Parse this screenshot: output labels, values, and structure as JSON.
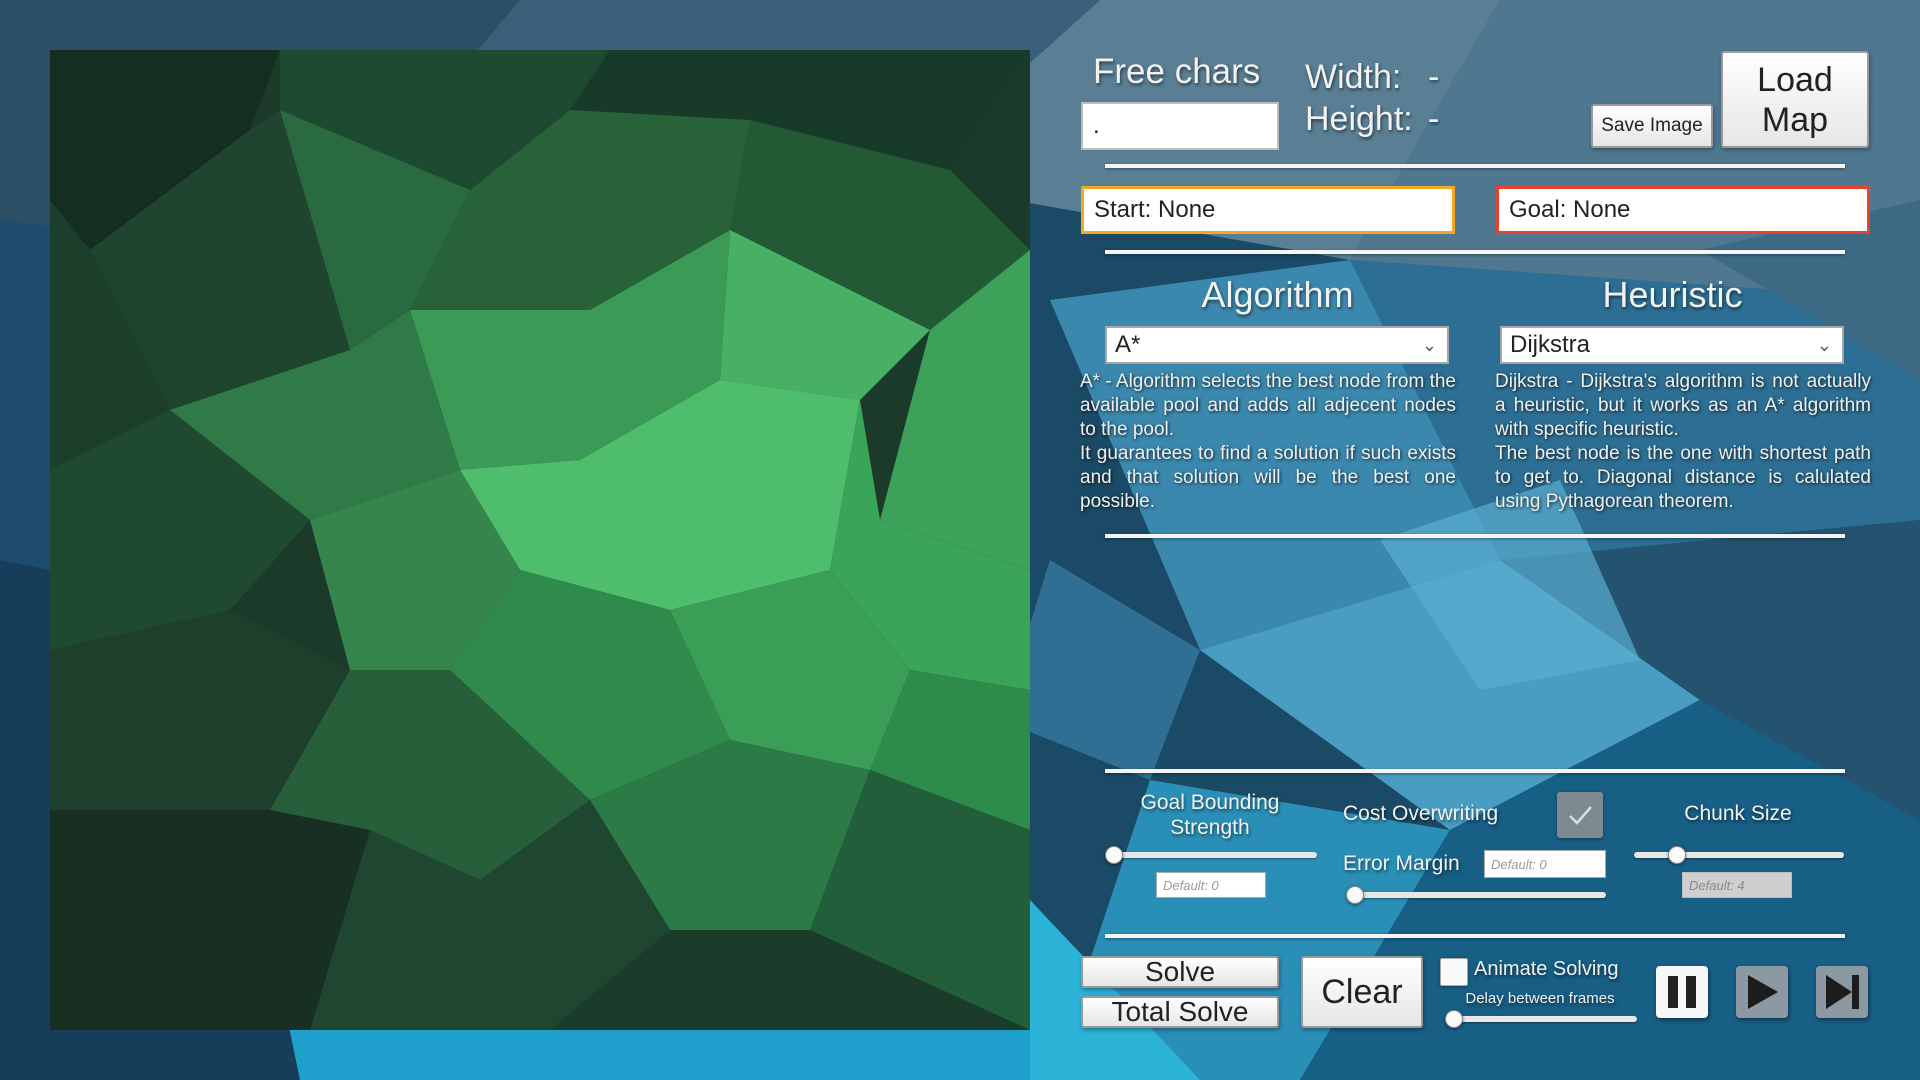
{
  "header": {
    "free_chars_label": "Free chars",
    "free_chars_value": ".",
    "width_label": "Width:",
    "width_value": "-",
    "height_label": "Height:",
    "height_value": "-",
    "save_image_label": "Save Image",
    "load_map_line1": "Load",
    "load_map_line2": "Map"
  },
  "points": {
    "start_label": "Start: None",
    "goal_label": "Goal: None",
    "start_border_color": "#f5a623",
    "goal_border_color": "#e8412c"
  },
  "algorithm": {
    "title": "Algorithm",
    "selected": "A*",
    "description": [
      "A* - Algorithm selects the best node from the available pool and adds all adjecent nodes to the pool.",
      "It guarantees to find a solution if such exists and that solution will be the best one possible."
    ]
  },
  "heuristic": {
    "title": "Heuristic",
    "selected": "Dijkstra",
    "description": [
      "Dijkstra - Dijkstra's algorithm is not actually a heuristic, but it works as an A* algorithm with specific heuristic.",
      "The best node is the one with shortest path to get to. Diagonal distance is calulated using Pythagorean theorem."
    ]
  },
  "settings": {
    "goal_bounding_label": "Goal Bounding Strength",
    "goal_bounding_placeholder": "Default: 0",
    "goal_bounding_level": 0,
    "cost_overwriting_label": "Cost Overwriting",
    "cost_overwriting_checked": true,
    "error_margin_label": "Error Margin",
    "error_margin_placeholder": "Default: 0",
    "error_margin_level": 0,
    "chunk_size_label": "Chunk Size",
    "chunk_size_placeholder": "Default: 4",
    "chunk_size_level": 0.17
  },
  "controls": {
    "solve_label": "Solve",
    "total_solve_label": "Total Solve",
    "clear_label": "Clear",
    "animate_label": "Animate Solving",
    "animate_checked": false,
    "delay_label": "Delay between frames",
    "delay_level": 0,
    "pause_icon": "pause-icon",
    "play_icon": "play-icon",
    "step_icon": "step-forward-icon"
  }
}
